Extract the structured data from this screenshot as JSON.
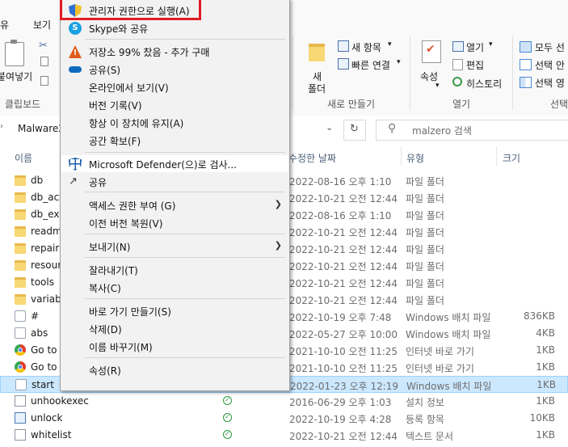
{
  "ribbon": {
    "tabs": [
      "유",
      "보기"
    ],
    "paste_label": "붙여넣기",
    "clipboard_group": "클립보드",
    "new_item": "새 항목",
    "quick_access": "빠른 연결",
    "new_folder_line1": "새",
    "new_folder_line2": "폴더",
    "new_group": "새로 만들기",
    "properties": "속성",
    "open": "열기",
    "edit": "편집",
    "history": "히스토리",
    "open_group": "열기",
    "select_all": "모두 선",
    "select_none": "선택 안",
    "invert_selection": "선택 영",
    "select_group": "선택"
  },
  "address": {
    "breadcrumb": "Malware2",
    "search_placeholder": "malzero 검색"
  },
  "columns": {
    "name": "이름",
    "date": "수정한 날짜",
    "type": "유형",
    "size": "크기"
  },
  "files": [
    {
      "name": "db",
      "date": "2022-08-16 오후 1:10",
      "type": "파일 폴더",
      "size": "",
      "icon": "folder"
    },
    {
      "name": "db_act",
      "date": "2022-10-21 오전 12:44",
      "type": "파일 폴더",
      "size": "",
      "icon": "folder"
    },
    {
      "name": "db_exe",
      "date": "2022-08-16 오후 1:10",
      "type": "파일 폴더",
      "size": "",
      "icon": "folder"
    },
    {
      "name": "readm",
      "date": "2022-10-21 오전 12:44",
      "type": "파일 폴더",
      "size": "",
      "icon": "folder"
    },
    {
      "name": "repair",
      "date": "2022-10-21 오전 12:44",
      "type": "파일 폴더",
      "size": "",
      "icon": "folder"
    },
    {
      "name": "resour",
      "date": "2022-10-21 오전 12:44",
      "type": "파일 폴더",
      "size": "",
      "icon": "folder"
    },
    {
      "name": "tools",
      "date": "2022-10-21 오전 12:44",
      "type": "파일 폴더",
      "size": "",
      "icon": "folder"
    },
    {
      "name": "variab",
      "date": "2022-10-21 오전 12:44",
      "type": "파일 폴더",
      "size": "",
      "icon": "folder"
    },
    {
      "name": "#",
      "date": "2022-10-19 오후 7:48",
      "type": "Windows 배치 파일",
      "size": "836KB",
      "icon": "batch"
    },
    {
      "name": "abs",
      "date": "2022-05-27 오후 10:00",
      "type": "Windows 배치 파일",
      "size": "4KB",
      "icon": "batch"
    },
    {
      "name": "Go to",
      "date": "2021-10-10 오전 11:25",
      "type": "인터넷 바로 가기",
      "size": "1KB",
      "icon": "url"
    },
    {
      "name": "Go to",
      "date": "2021-10-10 오전 11:25",
      "type": "인터넷 바로 가기",
      "size": "1KB",
      "icon": "url"
    },
    {
      "name": "start",
      "date": "2022-01-23 오후 12:19",
      "type": "Windows 배치 파일",
      "size": "1KB",
      "icon": "batch"
    },
    {
      "name": "unhookexec",
      "date": "2016-06-29 오후 1:03",
      "type": "설치 정보",
      "size": "1KB",
      "icon": "doc"
    },
    {
      "name": "unlock",
      "date": "2022-10-19 오후 4:28",
      "type": "등록 항목",
      "size": "10KB",
      "icon": "reg"
    },
    {
      "name": "whitelist",
      "date": "2022-10-21 오전 12:44",
      "type": "텍스트 문서",
      "size": "1KB",
      "icon": "doc"
    }
  ],
  "selected_file": "start",
  "status_check": "✓",
  "menu": {
    "run_as_admin": "관리자 권한으로 실행(A)",
    "skype_share": "Skype와 공유",
    "storage": "저장소 99% 찼음 - 추가 구매",
    "share_s": "공유(S)",
    "view_online": "온라인에서 보기(V)",
    "version_history": "버전 기록(V)",
    "keep_on_device": "항상 이 장치에 유지(A)",
    "free_space": "공간 확보(F)",
    "defender_scan": "Microsoft Defender(으)로 검사...",
    "share": "공유",
    "give_access": "액세스 권한 부여 (G)",
    "restore_versions": "이전 버전 복원(V)",
    "send_to": "보내기(N)",
    "cut": "잘라내기(T)",
    "copy": "복사(C)",
    "create_shortcut": "바로 가기 만들기(S)",
    "delete": "삭제(D)",
    "rename": "이름 바꾸기(M)",
    "properties": "속성(R)"
  },
  "colors": {
    "highlight_box": "#e01b24",
    "selection": "#cce8ff",
    "status_green": "#2e9a3f"
  }
}
